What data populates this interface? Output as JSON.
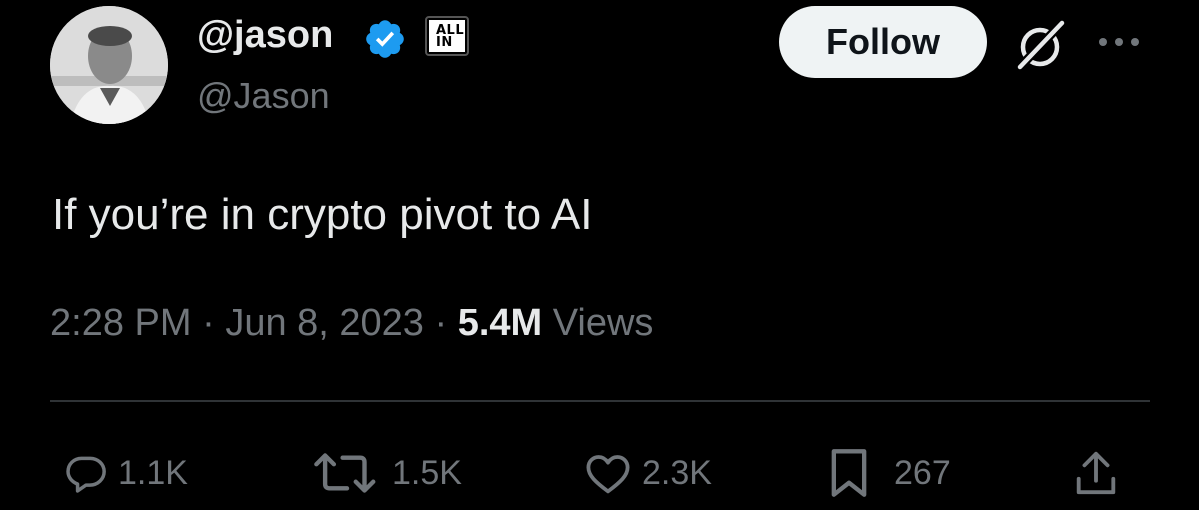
{
  "author": {
    "display_name": "@jason",
    "handle": "@Jason",
    "org_badge": [
      "ALL",
      "IN"
    ],
    "verified_icon": "verified-checkmark-icon",
    "verified_color": "#1d9bf0"
  },
  "header": {
    "follow_label": "Follow",
    "grok_icon": "grok-icon",
    "more_icon": "more-options-icon"
  },
  "tweet": {
    "text": "If you’re in crypto pivot to AI",
    "time": "2:28 PM",
    "date": "Jun 8, 2023",
    "separator": "·",
    "views_count": "5.4M",
    "views_label": "Views"
  },
  "actions": {
    "replies": "1.1K",
    "reposts": "1.5K",
    "likes": "2.3K",
    "bookmarks": "267"
  },
  "colors": {
    "background": "#000000",
    "primary_text": "#e7e9ea",
    "secondary_text": "#71767b",
    "divider": "#2f3336",
    "follow_bg": "#eff3f4"
  }
}
